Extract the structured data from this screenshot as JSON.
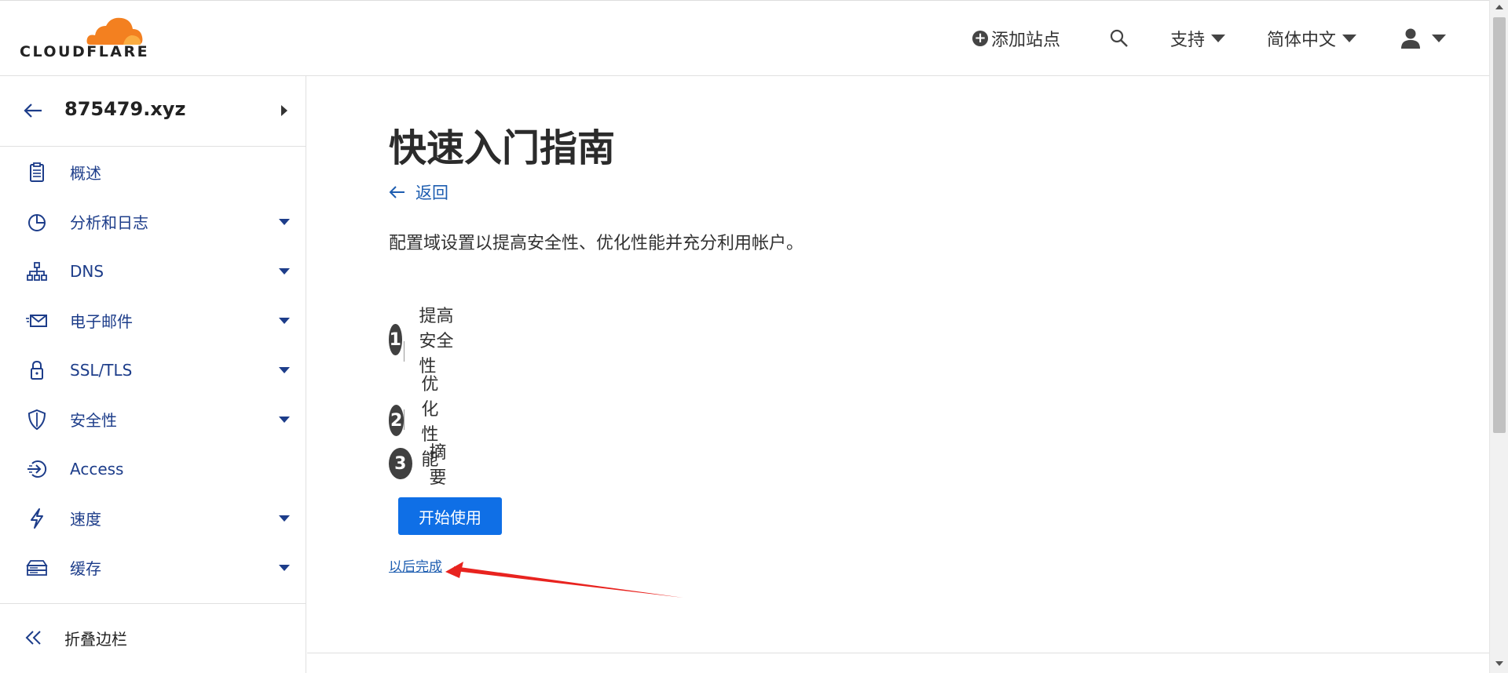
{
  "header": {
    "logo_text": "CLOUDFLARE",
    "add_site_label": "添加站点",
    "support_label": "支持",
    "language_label": "简体中文"
  },
  "sidebar": {
    "zone_name": "875479.xyz",
    "items": [
      {
        "label": "概述",
        "icon": "clipboard-icon",
        "has_caret": false
      },
      {
        "label": "分析和日志",
        "icon": "pie-chart-icon",
        "has_caret": true
      },
      {
        "label": "DNS",
        "icon": "network-icon",
        "has_caret": true
      },
      {
        "label": "电子邮件",
        "icon": "email-icon",
        "has_caret": true
      },
      {
        "label": "SSL/TLS",
        "icon": "lock-icon",
        "has_caret": true
      },
      {
        "label": "安全性",
        "icon": "shield-icon",
        "has_caret": true
      },
      {
        "label": "Access",
        "icon": "access-icon",
        "has_caret": false
      },
      {
        "label": "速度",
        "icon": "lightning-icon",
        "has_caret": true
      },
      {
        "label": "缓存",
        "icon": "storage-icon",
        "has_caret": true
      }
    ],
    "collapse_label": "折叠边栏"
  },
  "main": {
    "title": "快速入门指南",
    "back_label": "返回",
    "description": "配置域设置以提高安全性、优化性能并充分利用帐户。",
    "steps": [
      {
        "number": "1",
        "label": "提高安全性"
      },
      {
        "number": "2",
        "label": "优化性能"
      },
      {
        "number": "3",
        "label": "摘要"
      }
    ],
    "start_button": "开始使用",
    "later_link": "以后完成"
  },
  "colors": {
    "brand_orange": "#f38020",
    "link_blue": "#1d5db0",
    "primary_button": "#0f6fe6",
    "annotation_red": "#e8231f"
  }
}
